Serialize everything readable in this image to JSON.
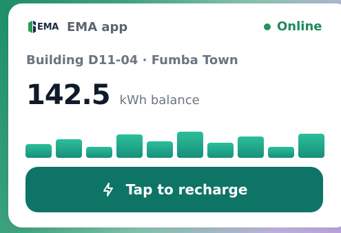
{
  "header": {
    "logo_text": "EMA",
    "app_name": "EMA app",
    "status_label": "Online"
  },
  "location": "Building D11-04 · Fumba Town",
  "balance": {
    "value": "142.5",
    "unit_label": "kWh balance"
  },
  "usage_bars": {
    "relative_levels": [
      0.45,
      0.62,
      0.36,
      0.78,
      0.54,
      0.86,
      0.5,
      0.7,
      0.36,
      0.8
    ]
  },
  "recharge": {
    "label": "Tap to recharge",
    "icon": "lightning-bolt-icon"
  },
  "colors": {
    "accent": "#0e7466",
    "online": "#1f8a5c",
    "bar_top": "#2bbf9a",
    "bar_bottom": "#18907a"
  }
}
